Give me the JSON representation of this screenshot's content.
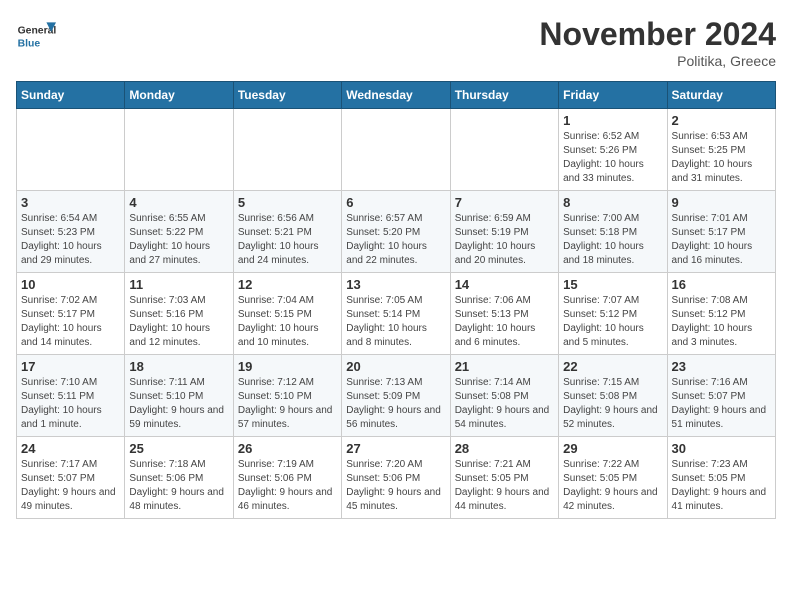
{
  "header": {
    "logo_general": "General",
    "logo_blue": "Blue",
    "month_title": "November 2024",
    "location": "Politika, Greece"
  },
  "weekdays": [
    "Sunday",
    "Monday",
    "Tuesday",
    "Wednesday",
    "Thursday",
    "Friday",
    "Saturday"
  ],
  "weeks": [
    [
      {
        "day": "",
        "info": ""
      },
      {
        "day": "",
        "info": ""
      },
      {
        "day": "",
        "info": ""
      },
      {
        "day": "",
        "info": ""
      },
      {
        "day": "",
        "info": ""
      },
      {
        "day": "1",
        "info": "Sunrise: 6:52 AM\nSunset: 5:26 PM\nDaylight: 10 hours and 33 minutes."
      },
      {
        "day": "2",
        "info": "Sunrise: 6:53 AM\nSunset: 5:25 PM\nDaylight: 10 hours and 31 minutes."
      }
    ],
    [
      {
        "day": "3",
        "info": "Sunrise: 6:54 AM\nSunset: 5:23 PM\nDaylight: 10 hours and 29 minutes."
      },
      {
        "day": "4",
        "info": "Sunrise: 6:55 AM\nSunset: 5:22 PM\nDaylight: 10 hours and 27 minutes."
      },
      {
        "day": "5",
        "info": "Sunrise: 6:56 AM\nSunset: 5:21 PM\nDaylight: 10 hours and 24 minutes."
      },
      {
        "day": "6",
        "info": "Sunrise: 6:57 AM\nSunset: 5:20 PM\nDaylight: 10 hours and 22 minutes."
      },
      {
        "day": "7",
        "info": "Sunrise: 6:59 AM\nSunset: 5:19 PM\nDaylight: 10 hours and 20 minutes."
      },
      {
        "day": "8",
        "info": "Sunrise: 7:00 AM\nSunset: 5:18 PM\nDaylight: 10 hours and 18 minutes."
      },
      {
        "day": "9",
        "info": "Sunrise: 7:01 AM\nSunset: 5:17 PM\nDaylight: 10 hours and 16 minutes."
      }
    ],
    [
      {
        "day": "10",
        "info": "Sunrise: 7:02 AM\nSunset: 5:17 PM\nDaylight: 10 hours and 14 minutes."
      },
      {
        "day": "11",
        "info": "Sunrise: 7:03 AM\nSunset: 5:16 PM\nDaylight: 10 hours and 12 minutes."
      },
      {
        "day": "12",
        "info": "Sunrise: 7:04 AM\nSunset: 5:15 PM\nDaylight: 10 hours and 10 minutes."
      },
      {
        "day": "13",
        "info": "Sunrise: 7:05 AM\nSunset: 5:14 PM\nDaylight: 10 hours and 8 minutes."
      },
      {
        "day": "14",
        "info": "Sunrise: 7:06 AM\nSunset: 5:13 PM\nDaylight: 10 hours and 6 minutes."
      },
      {
        "day": "15",
        "info": "Sunrise: 7:07 AM\nSunset: 5:12 PM\nDaylight: 10 hours and 5 minutes."
      },
      {
        "day": "16",
        "info": "Sunrise: 7:08 AM\nSunset: 5:12 PM\nDaylight: 10 hours and 3 minutes."
      }
    ],
    [
      {
        "day": "17",
        "info": "Sunrise: 7:10 AM\nSunset: 5:11 PM\nDaylight: 10 hours and 1 minute."
      },
      {
        "day": "18",
        "info": "Sunrise: 7:11 AM\nSunset: 5:10 PM\nDaylight: 9 hours and 59 minutes."
      },
      {
        "day": "19",
        "info": "Sunrise: 7:12 AM\nSunset: 5:10 PM\nDaylight: 9 hours and 57 minutes."
      },
      {
        "day": "20",
        "info": "Sunrise: 7:13 AM\nSunset: 5:09 PM\nDaylight: 9 hours and 56 minutes."
      },
      {
        "day": "21",
        "info": "Sunrise: 7:14 AM\nSunset: 5:08 PM\nDaylight: 9 hours and 54 minutes."
      },
      {
        "day": "22",
        "info": "Sunrise: 7:15 AM\nSunset: 5:08 PM\nDaylight: 9 hours and 52 minutes."
      },
      {
        "day": "23",
        "info": "Sunrise: 7:16 AM\nSunset: 5:07 PM\nDaylight: 9 hours and 51 minutes."
      }
    ],
    [
      {
        "day": "24",
        "info": "Sunrise: 7:17 AM\nSunset: 5:07 PM\nDaylight: 9 hours and 49 minutes."
      },
      {
        "day": "25",
        "info": "Sunrise: 7:18 AM\nSunset: 5:06 PM\nDaylight: 9 hours and 48 minutes."
      },
      {
        "day": "26",
        "info": "Sunrise: 7:19 AM\nSunset: 5:06 PM\nDaylight: 9 hours and 46 minutes."
      },
      {
        "day": "27",
        "info": "Sunrise: 7:20 AM\nSunset: 5:06 PM\nDaylight: 9 hours and 45 minutes."
      },
      {
        "day": "28",
        "info": "Sunrise: 7:21 AM\nSunset: 5:05 PM\nDaylight: 9 hours and 44 minutes."
      },
      {
        "day": "29",
        "info": "Sunrise: 7:22 AM\nSunset: 5:05 PM\nDaylight: 9 hours and 42 minutes."
      },
      {
        "day": "30",
        "info": "Sunrise: 7:23 AM\nSunset: 5:05 PM\nDaylight: 9 hours and 41 minutes."
      }
    ]
  ]
}
